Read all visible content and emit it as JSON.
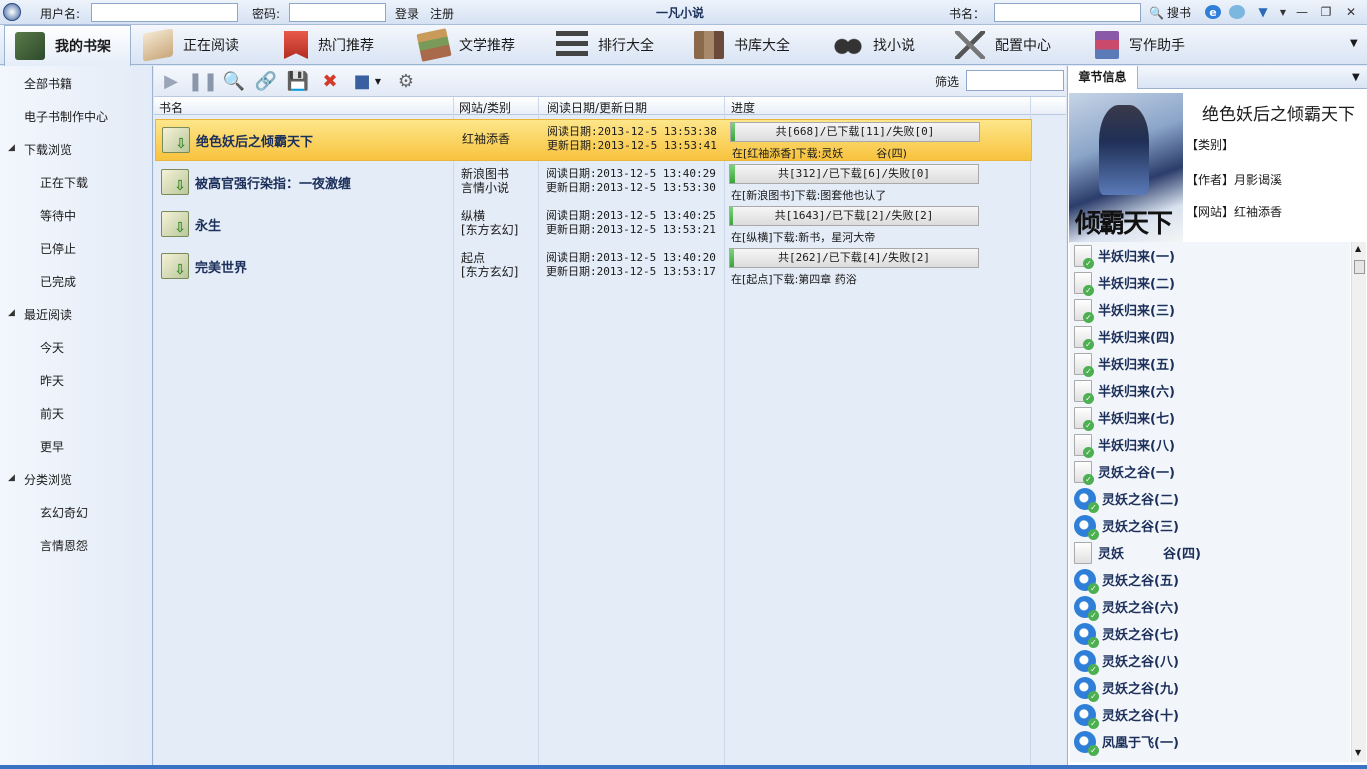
{
  "topbar": {
    "username_label": "用户名:",
    "password_label": "密码:",
    "login": "登录",
    "register": "注册",
    "app_title": "一凡小说",
    "book_name_label": "书名：",
    "search": "搜书",
    "username_value": "",
    "password_value": "",
    "book_search_value": ""
  },
  "nav": [
    {
      "label": "我的书架",
      "icon": "bookshelf-icon"
    },
    {
      "label": "正在阅读",
      "icon": "open-book-icon"
    },
    {
      "label": "热门推荐",
      "icon": "ribbon-bookmark-icon"
    },
    {
      "label": "文学推荐",
      "icon": "books-stack-icon"
    },
    {
      "label": "排行大全",
      "icon": "ranking-list-icon"
    },
    {
      "label": "书库大全",
      "icon": "library-books-icon"
    },
    {
      "label": "找小说",
      "icon": "binoculars-icon"
    },
    {
      "label": "配置中心",
      "icon": "tools-icon"
    },
    {
      "label": "写作助手",
      "icon": "writing-books-icon"
    }
  ],
  "sidebar": {
    "all_books": "全部书籍",
    "ebook_center": "电子书制作中心",
    "download_group": "下载浏览",
    "downloading": "正在下载",
    "waiting": "等待中",
    "stopped": "已停止",
    "completed": "已完成",
    "recent_group": "最近阅读",
    "today": "今天",
    "yesterday": "昨天",
    "day_before": "前天",
    "earlier": "更早",
    "category_group": "分类浏览",
    "fantasy": "玄幻奇幻",
    "romance": "言情恩怨"
  },
  "toolbar": {
    "filter_label": "筛选",
    "filter_value": ""
  },
  "table": {
    "headers": [
      "书名",
      "网站/类别",
      "阅读日期/更新日期",
      "进度"
    ],
    "rows": [
      {
        "name": "绝色妖后之倾霸天下",
        "site": "红袖添香",
        "category": "",
        "read_date": "阅读日期:2013-12-5 13:53:38",
        "update_date": "更新日期:2013-12-5 13:53:41",
        "progress_text": "共[668]/已下载[11]/失败[0]",
        "progress_fraction": 0.016,
        "status": "在[红袖添香]下载:灵妖　　　谷(四)",
        "selected": true
      },
      {
        "name": "被高官强行染指：一夜激缠",
        "site": "新浪图书",
        "category": "言情小说",
        "read_date": "阅读日期:2013-12-5 13:40:29",
        "update_date": "更新日期:2013-12-5 13:53:30",
        "progress_text": "共[312]/已下载[6]/失败[0]",
        "progress_fraction": 0.019,
        "status": "在[新浪图书]下载:图套他也认了",
        "selected": false
      },
      {
        "name": "永生",
        "site": "纵横",
        "category": "[东方玄幻]",
        "read_date": "阅读日期:2013-12-5 13:40:25",
        "update_date": "更新日期:2013-12-5 13:53:21",
        "progress_text": "共[1643]/已下载[2]/失败[2]",
        "progress_fraction": 0.001,
        "status": "在[纵横]下载:新书，星河大帝",
        "selected": false
      },
      {
        "name": "完美世界",
        "site": "起点",
        "category": "[东方玄幻]",
        "read_date": "阅读日期:2013-12-5 13:40:20",
        "update_date": "更新日期:2013-12-5 13:53:17",
        "progress_text": "共[262]/已下载[4]/失败[2]",
        "progress_fraction": 0.015,
        "status": "在[起点]下载:第四章 药浴",
        "selected": false
      }
    ]
  },
  "right_panel": {
    "tab": "章节信息",
    "title": "绝色妖后之倾霸天下",
    "category_label": "【类别】",
    "author_label": "【作者】月影谒溪",
    "site_label": "【网站】红袖添香",
    "cover_text": "倾霸天下",
    "chapters": [
      {
        "title": "半妖归来(一)",
        "icon": "document-check-icon"
      },
      {
        "title": "半妖归来(二)",
        "icon": "document-check-icon"
      },
      {
        "title": "半妖归来(三)",
        "icon": "document-check-icon"
      },
      {
        "title": "半妖归来(四)",
        "icon": "document-check-icon"
      },
      {
        "title": "半妖归来(五)",
        "icon": "document-check-icon"
      },
      {
        "title": "半妖归来(六)",
        "icon": "document-check-icon"
      },
      {
        "title": "半妖归来(七)",
        "icon": "document-check-icon"
      },
      {
        "title": "半妖归来(八)",
        "icon": "document-check-icon"
      },
      {
        "title": "灵妖之谷(一)",
        "icon": "document-check-icon"
      },
      {
        "title": "灵妖之谷(二)",
        "icon": "ie-check-icon"
      },
      {
        "title": "灵妖之谷(三)",
        "icon": "ie-check-icon"
      },
      {
        "title": "灵妖　　　谷(四)",
        "icon": "document-icon"
      },
      {
        "title": "灵妖之谷(五)",
        "icon": "ie-check-icon"
      },
      {
        "title": "灵妖之谷(六)",
        "icon": "ie-check-icon"
      },
      {
        "title": "灵妖之谷(七)",
        "icon": "ie-check-icon"
      },
      {
        "title": "灵妖之谷(八)",
        "icon": "ie-check-icon"
      },
      {
        "title": "灵妖之谷(九)",
        "icon": "ie-check-icon"
      },
      {
        "title": "灵妖之谷(十)",
        "icon": "ie-check-icon"
      },
      {
        "title": "凤凰于飞(一)",
        "icon": "ie-check-icon"
      }
    ]
  }
}
